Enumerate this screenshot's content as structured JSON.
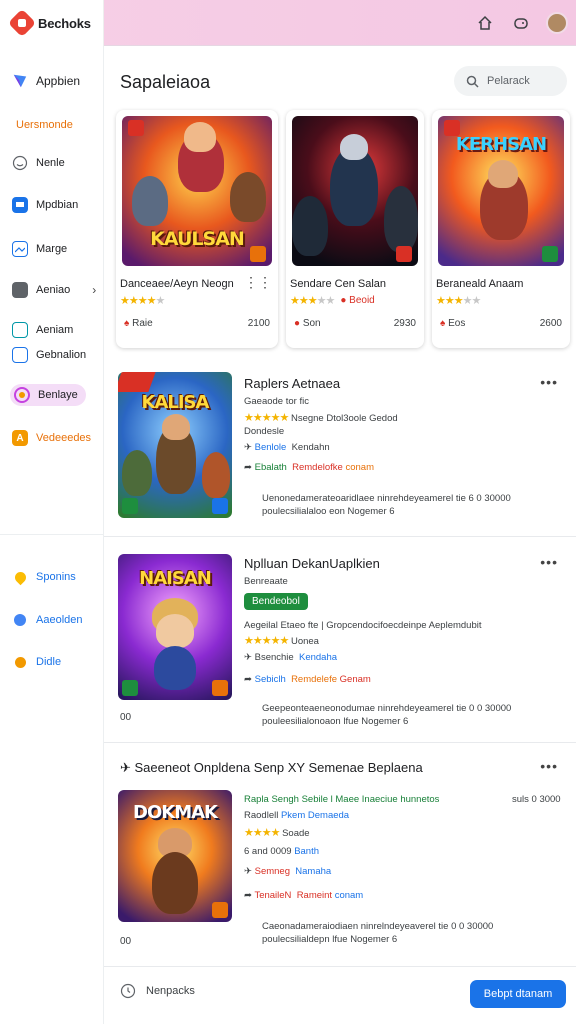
{
  "header": {
    "brand": "Bechoks"
  },
  "sidebar": {
    "items": [
      {
        "label": "Appbien",
        "icon": "app-icon"
      },
      {
        "label": "Uersmonde",
        "icon": ""
      },
      {
        "label": "Nenle",
        "icon": "smile-icon"
      },
      {
        "label": "Mpdbian",
        "icon": "monitor-icon"
      },
      {
        "label": "Marge",
        "icon": "image-icon"
      },
      {
        "label": "Aeniao",
        "icon": "book-icon"
      },
      {
        "label": "Aeniam",
        "icon": "person-icon"
      },
      {
        "label": "Gebnalion",
        "icon": "gallery-icon"
      },
      {
        "label": "Benlaye",
        "icon": "clock-icon"
      },
      {
        "label": "Vedeeedes",
        "icon": "letter-a-icon"
      },
      {
        "label": "Sponins",
        "icon": "drop-icon"
      },
      {
        "label": "Aaeolden",
        "icon": "person-icon"
      },
      {
        "label": "Didle",
        "icon": "drop-icon"
      }
    ]
  },
  "main": {
    "title": "Sapaleiaoa",
    "search_placeholder": "Pelarack",
    "cards": [
      {
        "art_title": "KAULSAN",
        "title": "Danceaee/Aeyn Neogn",
        "price": "Raie",
        "count": "2100",
        "rating": 4
      },
      {
        "art_title": "",
        "title": "Sendare Cen Salan",
        "price": "Son",
        "count": "2930",
        "rating": 3,
        "tag": "Beoid"
      },
      {
        "art_title": "KERHSAN",
        "title": "Beraneald Anaam",
        "price": "Eos",
        "count": "2600",
        "rating": 3
      }
    ],
    "rows": [
      {
        "art_title": "KALISA",
        "title": "Raplers Aetnaea",
        "subtitle": "Gaeaode tor fic",
        "rating_text": "Nsegne Dtol3oole Gedod",
        "line3": "Dondesle",
        "line4_a": "Benlole",
        "line4_b": "Kendahn",
        "line5_a": "Ebalath",
        "line5_b": "Remdelofke",
        "line5_c": "conam",
        "desc": "Uenonedamerateoaridlaee ninrehdeyeamerel tie 6 0 30000 poulecsilialaloo eon Nogemer 6",
        "num": ""
      },
      {
        "art_title": "NAISAN",
        "title": "Nplluan DekanUaplkien",
        "subtitle": "Benreaate",
        "badge": "Bendeobol",
        "rating_line": "Aegeilal Etaeo fte | Gropcendocifoecdeinpe Aeplemdubit",
        "rating_text": "Uonea",
        "line4_a": "Bsenchie",
        "line4_b": "Kendaha",
        "line5_a": "Sebiclh",
        "line5_b": "Remdelefe",
        "line5_c": "Genam",
        "desc": "Geepeonteaeneonodumae ninrehdeyeamerel tie 0 0 30000 pouleesilialonoaon lfue Nogemer 6",
        "num": "00"
      },
      {
        "art_title": "DOKMAK",
        "title": "Saeeneot Onpldena Senp XY Semenae Beplaena",
        "top_line": "Rapla Sengh Sebile l Maee Inaeciue hunnetos",
        "top_num": "suls 0 3000",
        "subtitle": "Raodlell",
        "subtitle_b": "Pkem Demaeda",
        "rating_text": "Soade",
        "line3_a": "6 and 0009",
        "line3_b": "Banth",
        "line4_a": "Semneg",
        "line4_b": "Namaha",
        "line5_a": "TenaileN",
        "line5_b": "Rameint",
        "line5_c": "conam",
        "desc": "Caeonadameraiodiaen ninrelndeyeaverel tie 0 0 30000 poulecsilialdepn lfue Nogemer 6",
        "num": "00"
      }
    ],
    "bottom": {
      "label": "Nenpacks",
      "button": "Bebpt dtanam"
    }
  },
  "colors": {
    "accent": "#1a73e8",
    "topbar": "#f6cfe6",
    "star": "#f4b400"
  }
}
